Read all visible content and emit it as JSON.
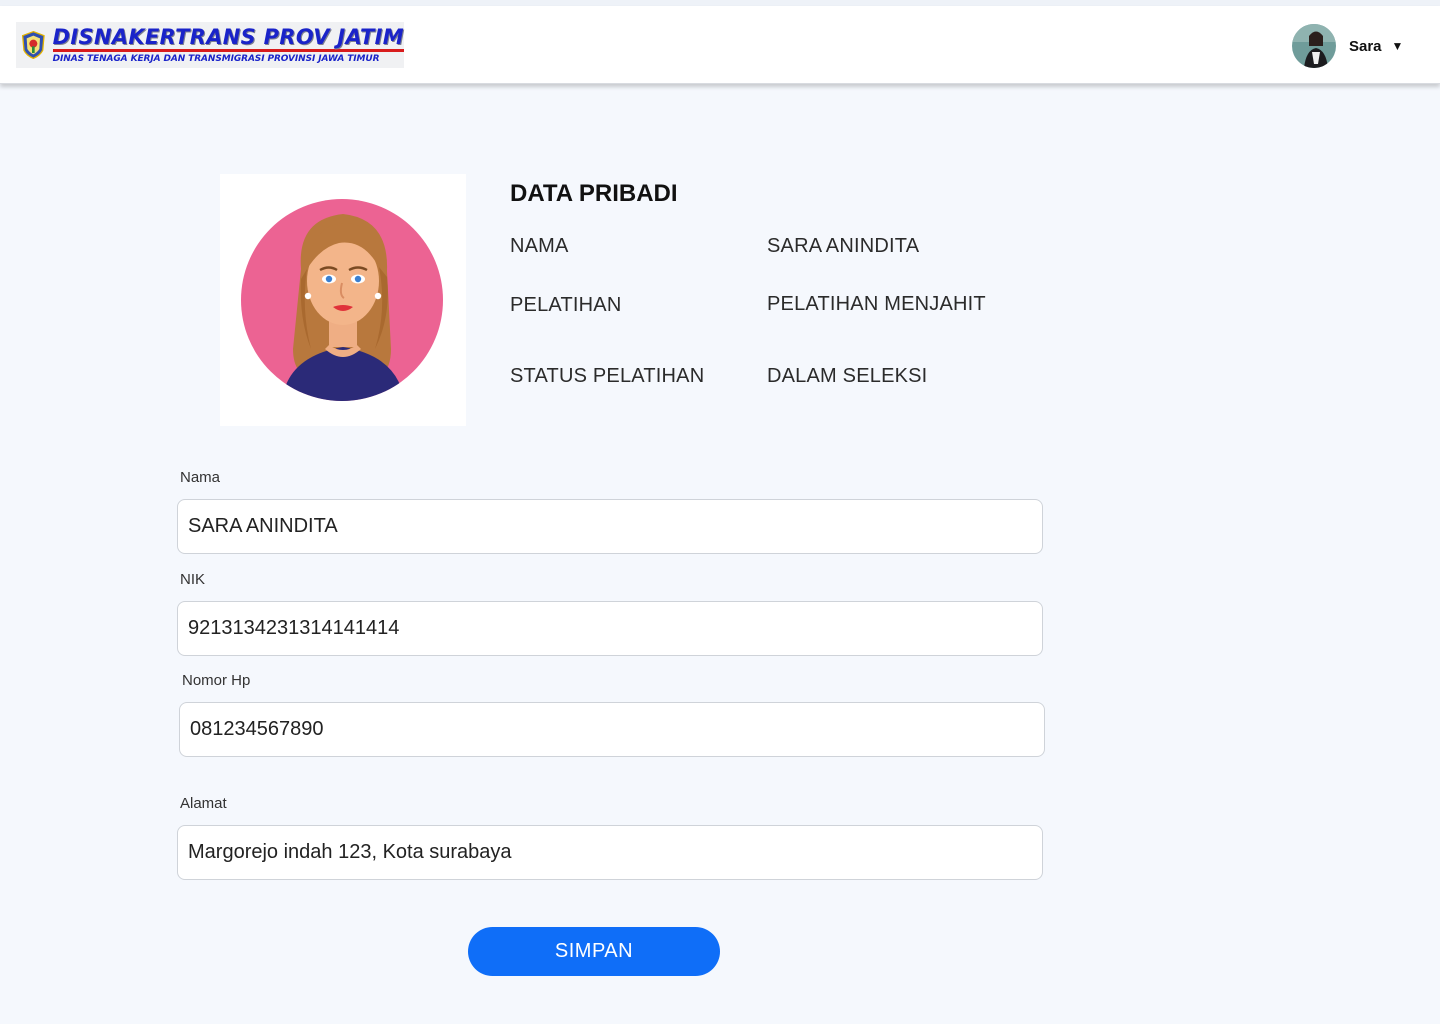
{
  "header": {
    "logo_title": "DISNAKERTRANS PROV JATIM",
    "logo_subtitle": "DINAS TENAGA KERJA DAN TRANSMIGRASI PROVINSI JAWA TIMUR",
    "user_name": "Sara",
    "caret_icon": "▼"
  },
  "profile": {
    "title": "DATA PRIBADI",
    "rows": [
      {
        "label": "NAMA",
        "value": "SARA ANINDITA"
      },
      {
        "label": "PELATIHAN",
        "value": "PELATIHAN MENJAHIT"
      },
      {
        "label": "STATUS PELATIHAN",
        "value": "DALAM SELEKSI"
      }
    ]
  },
  "form": {
    "nama": {
      "label": "Nama",
      "value": "SARA ANINDITA"
    },
    "nik": {
      "label": "NIK",
      "value": "9213134231314141414"
    },
    "hp": {
      "label": "Nomor Hp",
      "value": "081234567890"
    },
    "alamat": {
      "label": "Alamat",
      "value": "Margorejo indah 123, Kota surabaya"
    },
    "submit_label": "SIMPAN"
  },
  "colors": {
    "accent": "#0f6ef8",
    "background": "#f5f8fd",
    "logo_blue": "#1a23c9",
    "avatar_circle": "#ec6393"
  }
}
